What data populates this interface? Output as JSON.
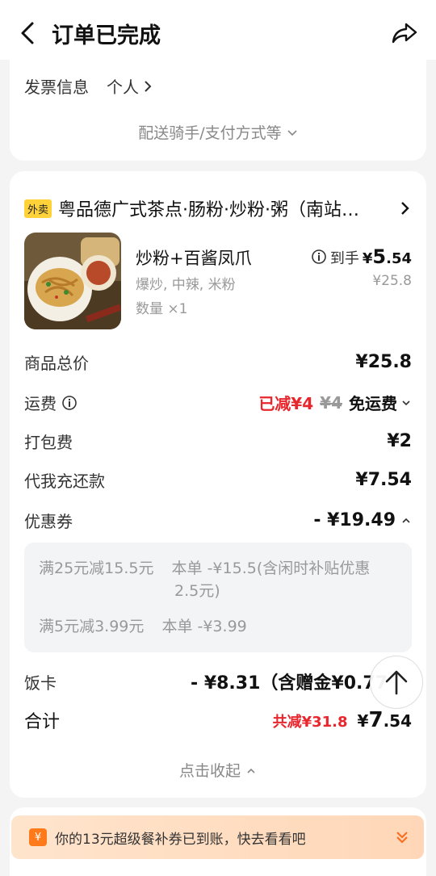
{
  "header": {
    "title": "订单已完成"
  },
  "invoice": {
    "label": "发票信息",
    "value": "个人",
    "more_label": "配送骑手/支付方式等"
  },
  "store": {
    "tag": "外卖",
    "name": "粤品德广式茶点·肠粉·炒粉·粥（南站…"
  },
  "item": {
    "name": "炒粉+百酱凤爪",
    "spec": "爆炒, 中辣, 米粉",
    "qty": "数量 ×1",
    "price_prefix": "到手",
    "price_symbol": "¥",
    "price_int": "5",
    "price_dec": ".54",
    "orig_price": "¥25.8"
  },
  "rows": {
    "total": {
      "label": "商品总价",
      "value": "¥25.8"
    },
    "delivery": {
      "label": "运费",
      "discount": "已减¥4",
      "orig": "¥4",
      "value": "免运费"
    },
    "packing": {
      "label": "打包费",
      "value": "¥2"
    },
    "repay": {
      "label": "代我充还款",
      "value": "¥7.54"
    },
    "coupon": {
      "label": "优惠券",
      "value": "- ¥19.49"
    }
  },
  "coupons": [
    {
      "name": "满25元减15.5元",
      "detail": "本单 -¥15.5(含闲时补贴优惠",
      "detail2": "2.5元)"
    },
    {
      "name": "满5元减3.99元",
      "detail": "本单 -¥3.99"
    }
  ],
  "meal_card": {
    "label": "饭卡",
    "value": "- ¥8.31（含赠金¥0.77"
  },
  "sum": {
    "label": "合计",
    "saved": "共减¥31.8",
    "symbol": "¥",
    "int": "7",
    "dec": ".54"
  },
  "collapse_label": "点击收起",
  "banner": {
    "icon_text": "¥",
    "text": "你的13元超级餐补券已到账，快去看看吧"
  },
  "colors": {
    "accent_red": "#e8262d",
    "tag_yellow": "#ffd23a",
    "banner_orange": "#ff7a1a"
  }
}
